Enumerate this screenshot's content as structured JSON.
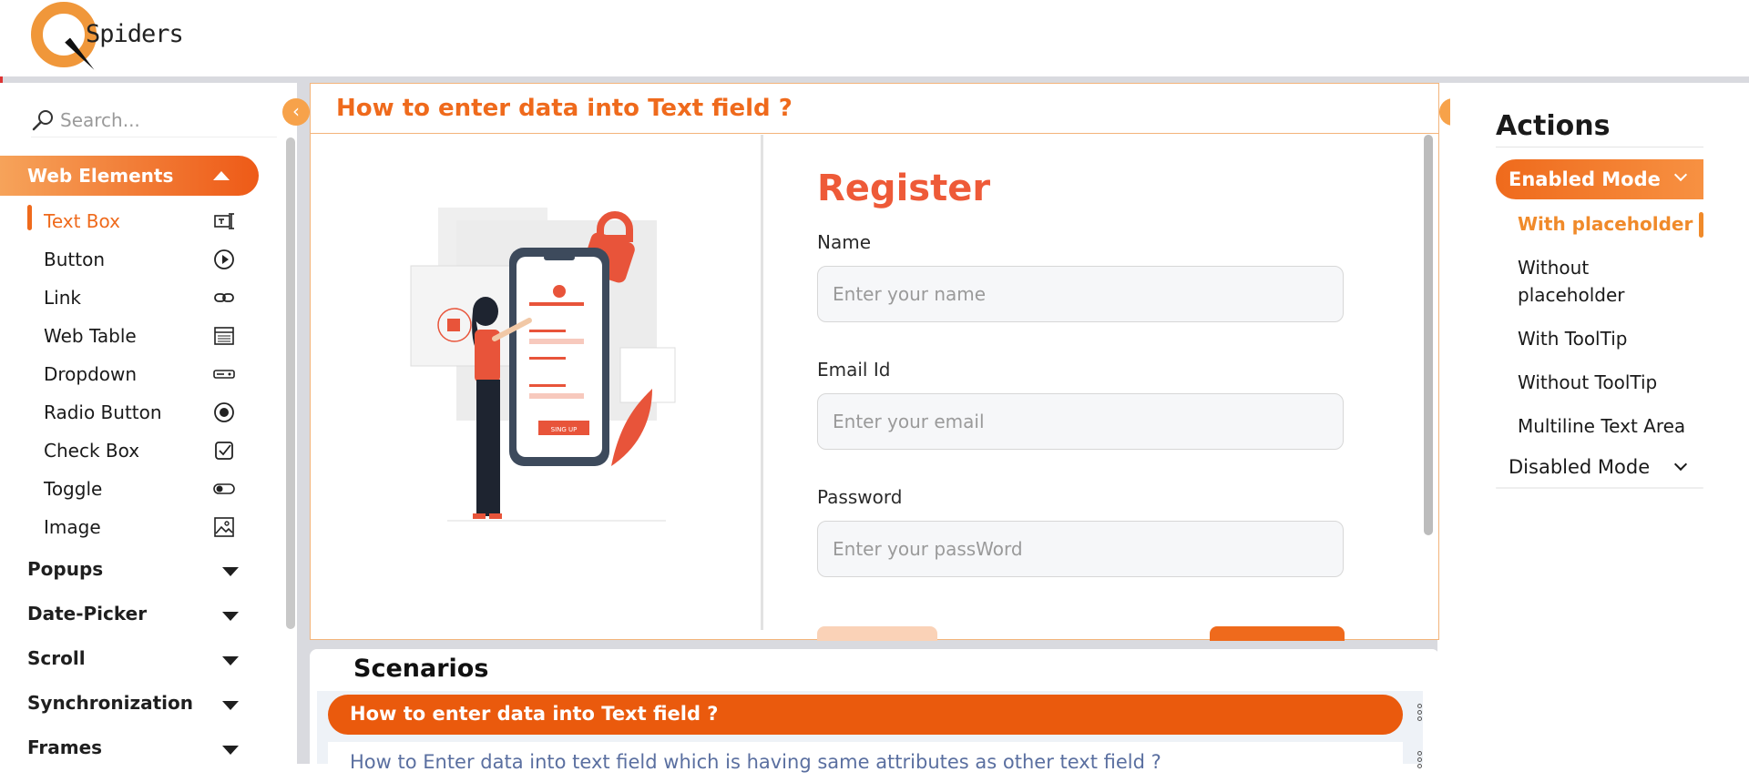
{
  "header": {
    "logo_text": "Spiders"
  },
  "search": {
    "placeholder": "Search..."
  },
  "sidebar": {
    "section": "Web Elements",
    "items": [
      {
        "label": "Text Box",
        "icon": "textbox-icon",
        "active": true
      },
      {
        "label": "Button",
        "icon": "play-circle-icon"
      },
      {
        "label": "Link",
        "icon": "link-icon"
      },
      {
        "label": "Web Table",
        "icon": "table-icon"
      },
      {
        "label": "Dropdown",
        "icon": "dropdown-icon"
      },
      {
        "label": "Radio Button",
        "icon": "radio-icon"
      },
      {
        "label": "Check Box",
        "icon": "checkbox-icon"
      },
      {
        "label": "Toggle",
        "icon": "toggle-icon"
      },
      {
        "label": "Image",
        "icon": "image-icon"
      }
    ],
    "groups": [
      "Popups",
      "Date-Picker",
      "Scroll",
      "Synchronization",
      "Frames"
    ]
  },
  "panel": {
    "title": "How to enter data into Text field ?",
    "register": "Register",
    "illustration_button": "SING UP",
    "fields": [
      {
        "label": "Name",
        "placeholder": "Enter your name"
      },
      {
        "label": "Email Id",
        "placeholder": "Enter your email"
      },
      {
        "label": "Password",
        "placeholder": "Enter your passWord"
      }
    ]
  },
  "scenarios": {
    "title": "Scenarios",
    "items": [
      "How to enter data into Text field ?",
      "How to Enter data into text field which is having same attributes as other text field ?"
    ]
  },
  "actions": {
    "title": "Actions",
    "enabled_mode": "Enabled Mode",
    "items": [
      "With placeholder",
      "Without placeholder",
      "With ToolTip",
      "Without ToolTip",
      "Multiline Text Area"
    ],
    "disabled_mode": "Disabled Mode"
  },
  "colors": {
    "accent": "#ef6a1c",
    "accent_light": "#f6a35a",
    "frame": "#d9dadf"
  }
}
